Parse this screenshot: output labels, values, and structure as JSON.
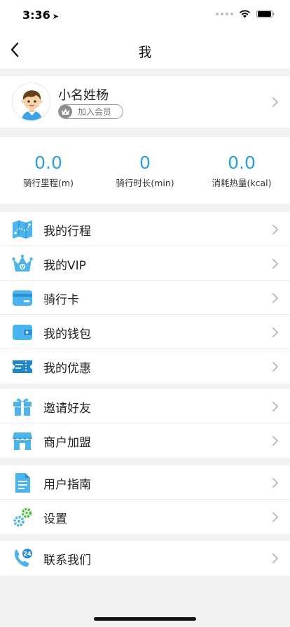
{
  "status_bar": {
    "time": "3:36"
  },
  "nav": {
    "title": "我"
  },
  "profile": {
    "name": "小名姓杨",
    "member_label": "加入会员"
  },
  "stats": [
    {
      "value": "0.0",
      "label": "骑行里程(m)"
    },
    {
      "value": "0",
      "label": "骑行时长(min)"
    },
    {
      "value": "0.0",
      "label": "消耗热量(kcal)"
    }
  ],
  "menu": {
    "trips": "我的行程",
    "vip": "我的VIP",
    "ride_card": "骑行卡",
    "wallet": "我的钱包",
    "coupons": "我的优惠",
    "invite": "邀请好友",
    "merchant": "商户加盟",
    "guide": "用户指南",
    "settings": "设置",
    "contact": "联系我们"
  },
  "icons": {
    "trips": "map-route-icon",
    "vip": "crown-icon",
    "ride_card": "card-icon",
    "wallet": "wallet-icon",
    "coupons": "ticket-icon",
    "invite": "gift-icon",
    "merchant": "shop-icon",
    "guide": "document-icon",
    "settings": "gears-icon",
    "contact": "phone-24-icon"
  },
  "colors": {
    "accent": "#2c9fdf",
    "icon_blue": "#3ab0ec",
    "settings_green": "#4cc23a"
  },
  "badges": {
    "contact_hours": "24"
  }
}
